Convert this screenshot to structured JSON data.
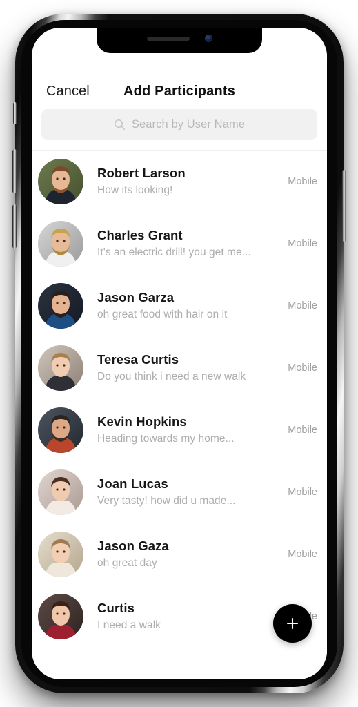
{
  "device": {
    "frame": "iphone-x",
    "notch": {
      "speaker": "earpiece-speaker",
      "camera": "front-camera"
    },
    "buttons": [
      "silent-switch",
      "volume-up",
      "volume-down",
      "power"
    ]
  },
  "nav": {
    "cancel_label": "Cancel",
    "title": "Add Participants"
  },
  "search": {
    "icon": "search-icon",
    "value": "",
    "placeholder": "Search by User Name"
  },
  "colors": {
    "accent": "#000000",
    "screen_bg": "#ffffff",
    "search_bg": "#f1f1f1",
    "primary_text": "#161616",
    "secondary_text": "#adadad",
    "meta_text": "#a0a0a0"
  },
  "participants": [
    {
      "name": "Robert Larson",
      "message": "How its looking!",
      "meta": "Mobile",
      "avatar": "man-beard-outdoors"
    },
    {
      "name": "Charles Grant",
      "message": "It's an electric drill! you get me...",
      "meta": "Mobile",
      "avatar": "man-blond-beard-workshop"
    },
    {
      "name": "Jason Garza",
      "message": "oh great food with hair on it",
      "meta": "Mobile",
      "avatar": "man-blue-suit-dark"
    },
    {
      "name": "Teresa Curtis",
      "message": "Do you think i need a new walk",
      "meta": "Mobile",
      "avatar": "woman-wavy-blonde"
    },
    {
      "name": "Kevin Hopkins",
      "message": "Heading towards my home...",
      "meta": "Mobile",
      "avatar": "man-sunglasses-plaid"
    },
    {
      "name": "Joan Lucas",
      "message": "Very tasty! how did u made...",
      "meta": "Mobile",
      "avatar": "woman-floral-crown"
    },
    {
      "name": "Jason Gaza",
      "message": "oh great day",
      "meta": "Mobile",
      "avatar": "woman-long-hair-outdoors"
    },
    {
      "name": "Curtis",
      "message": "I need a walk",
      "meta": "Mobile",
      "avatar": "woman-smiling-red-top"
    }
  ],
  "fab": {
    "icon": "plus-icon",
    "label": "Add"
  }
}
